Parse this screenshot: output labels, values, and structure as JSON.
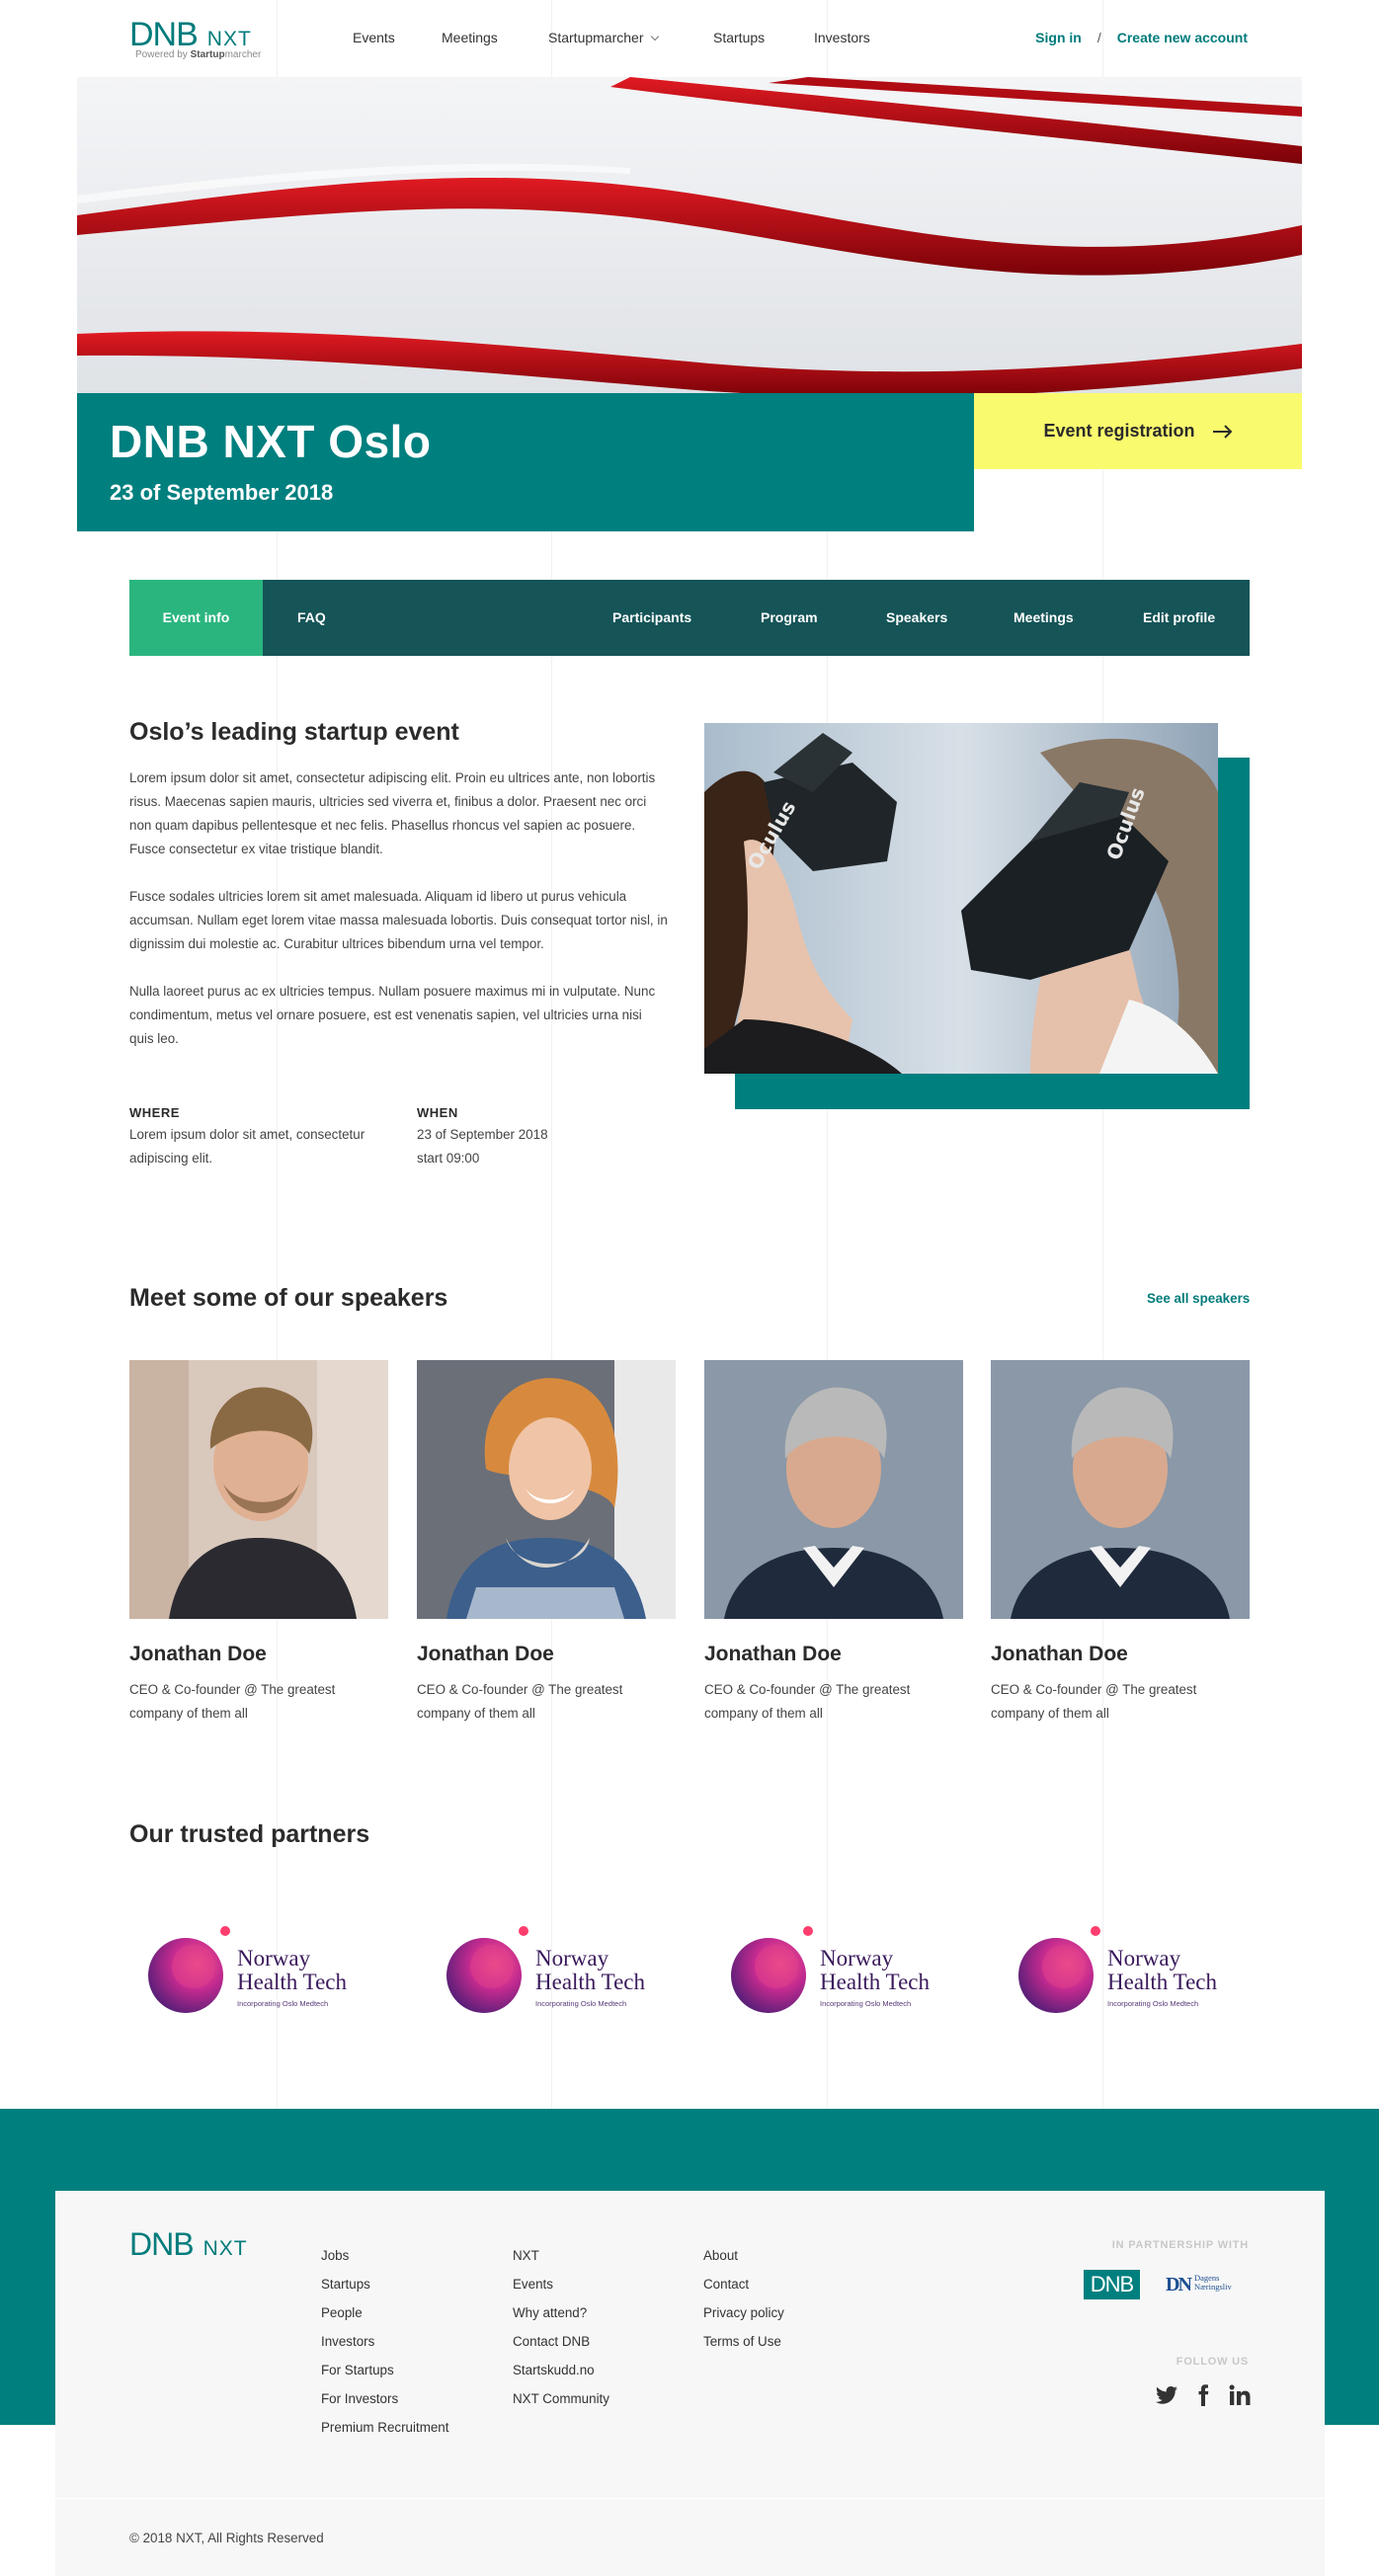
{
  "header": {
    "logo_dnb": "DNB",
    "logo_nxt": "NXT",
    "logo_powered": "Powered by",
    "logo_brand": "Startup",
    "logo_brand_rest": "marcher",
    "nav": [
      "Events",
      "Meetings",
      "Startupmarcher",
      "Startups",
      "Investors"
    ],
    "sign_in": "Sign in",
    "separator": "/",
    "create_account": "Create new account"
  },
  "hero": {
    "title": "DNB NXT Oslo",
    "date": "23 of September 2018",
    "registration_label": "Event registration",
    "registration_icon": "arrow-right-icon"
  },
  "tabs": {
    "left": [
      "Event info",
      "FAQ"
    ],
    "right": [
      "Participants",
      "Program",
      "Speakers",
      "Meetings",
      "Edit profile"
    ],
    "active": "Event info"
  },
  "about": {
    "title": "Oslo’s leading startup event",
    "paragraphs": [
      "Lorem ipsum dolor sit amet, consectetur adipiscing elit. Proin eu ultrices ante, non lobortis risus. Maecenas sapien mauris, ultricies sed viverra et, finibus a dolor. Praesent nec orci non quam dapibus pellentesque et nec felis. Phasellus rhoncus vel sapien ac posuere. Fusce consectetur ex vitae tristique blandit.",
      "Fusce sodales ultricies lorem sit amet malesuada. Aliquam id libero ut purus vehicula accumsan. Nullam eget lorem vitae massa malesuada lobortis. Duis consequat tortor nisl, in dignissim dui molestie ac. Curabitur ultrices bibendum urna vel tempor.",
      "Nulla laoreet purus ac ex ultricies tempus. Nullam posuere maximus mi in vulputate. Nunc condimentum, metus vel ornare posuere, est est venenatis sapien, vel ultricies urna nisi quis leo."
    ],
    "where_label": "WHERE",
    "where_value": "Lorem ipsum dolor sit amet, consectetur adipiscing elit.",
    "when_label": "WHEN",
    "when_date": "23 of September 2018",
    "when_time": "start 09:00",
    "vr_brand": "Oculus"
  },
  "speakers": {
    "title": "Meet some of our speakers",
    "see_all": "See all speakers",
    "items": [
      {
        "name": "Jonathan Doe",
        "role": "CEO & Co-founder @ The greatest company of them all"
      },
      {
        "name": "Jonathan Doe",
        "role": "CEO & Co-founder @ The greatest company of them all"
      },
      {
        "name": "Jonathan Doe",
        "role": "CEO & Co-founder @ The greatest company of them all"
      },
      {
        "name": "Jonathan Doe",
        "role": "CEO & Co-founder @ The greatest company of them all"
      }
    ]
  },
  "partners": {
    "title": "Our trusted partners",
    "items": [
      {
        "line1": "Norway",
        "line2": "Health Tech",
        "sub": "Incorporating Oslo Medtech"
      },
      {
        "line1": "Norway",
        "line2": "Health Tech",
        "sub": "Incorporating Oslo Medtech"
      },
      {
        "line1": "Norway",
        "line2": "Health Tech",
        "sub": "Incorporating Oslo Medtech"
      },
      {
        "line1": "Norway",
        "line2": "Health Tech",
        "sub": "Incorporating Oslo Medtech"
      }
    ]
  },
  "footer": {
    "logo_dnb": "DNB",
    "logo_nxt": "NXT",
    "col1": [
      "Jobs",
      "Startups",
      "People",
      "Investors",
      "For Startups",
      "For Investors",
      "Premium Recruitment"
    ],
    "col2": [
      "NXT",
      "Events",
      "Why attend?",
      "Contact DNB",
      "Startskudd.no",
      "NXT Community"
    ],
    "col3": [
      "About",
      "Contact",
      "Privacy policy",
      "Terms of Use"
    ],
    "partnership_label": "IN PARTNERSHIP WITH",
    "partner_dnb": "DNB",
    "partner_dn": "DN",
    "partner_dn_line1": "Dagens",
    "partner_dn_line2": "Næringsliv",
    "follow_label": "FOLLOW US",
    "social_icons": [
      "twitter-icon",
      "facebook-icon",
      "linkedin-icon"
    ],
    "copyright": "© 2018 NXT, All Rights Reserved"
  },
  "colors": {
    "teal": "#007f7f",
    "dark_teal": "#155457",
    "green_active": "#2ab57f",
    "yellow": "#fafa6e",
    "red_stripes": "#c4101a"
  }
}
